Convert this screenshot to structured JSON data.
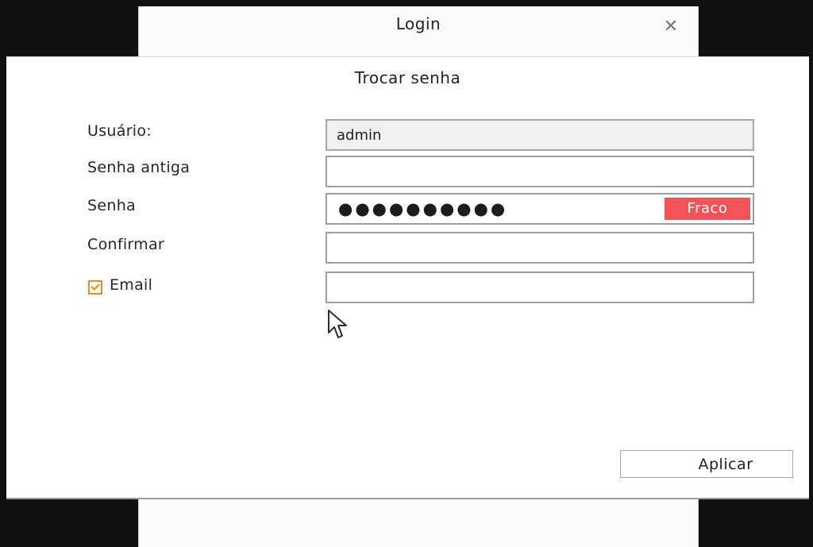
{
  "login_dialog": {
    "title": "Login",
    "close_icon": "close-icon",
    "close_symbol": "✕"
  },
  "change_password": {
    "title": "Trocar senha",
    "fields": {
      "user": {
        "label": "Usuário:",
        "value": "admin"
      },
      "old_password": {
        "label": "Senha antiga",
        "value": ""
      },
      "password": {
        "label": "Senha",
        "masked_value": "●●●●●●●●●●",
        "strength": "Fraco"
      },
      "confirm": {
        "label": "Confirmar",
        "value": ""
      },
      "email": {
        "label": "Email",
        "checked": true,
        "value": ""
      }
    },
    "apply_label": "Aplicar"
  },
  "colors": {
    "weak_strength": "#f15358",
    "checkbox_accent": "#f08a1f",
    "field_border": "#9d9d9d",
    "readonly_field_bg": "#efefef",
    "outer_background": "#111111"
  },
  "icons": {
    "close": "close-icon",
    "checkbox": "checkmark-icon",
    "cursor": "mouse-cursor-icon"
  }
}
